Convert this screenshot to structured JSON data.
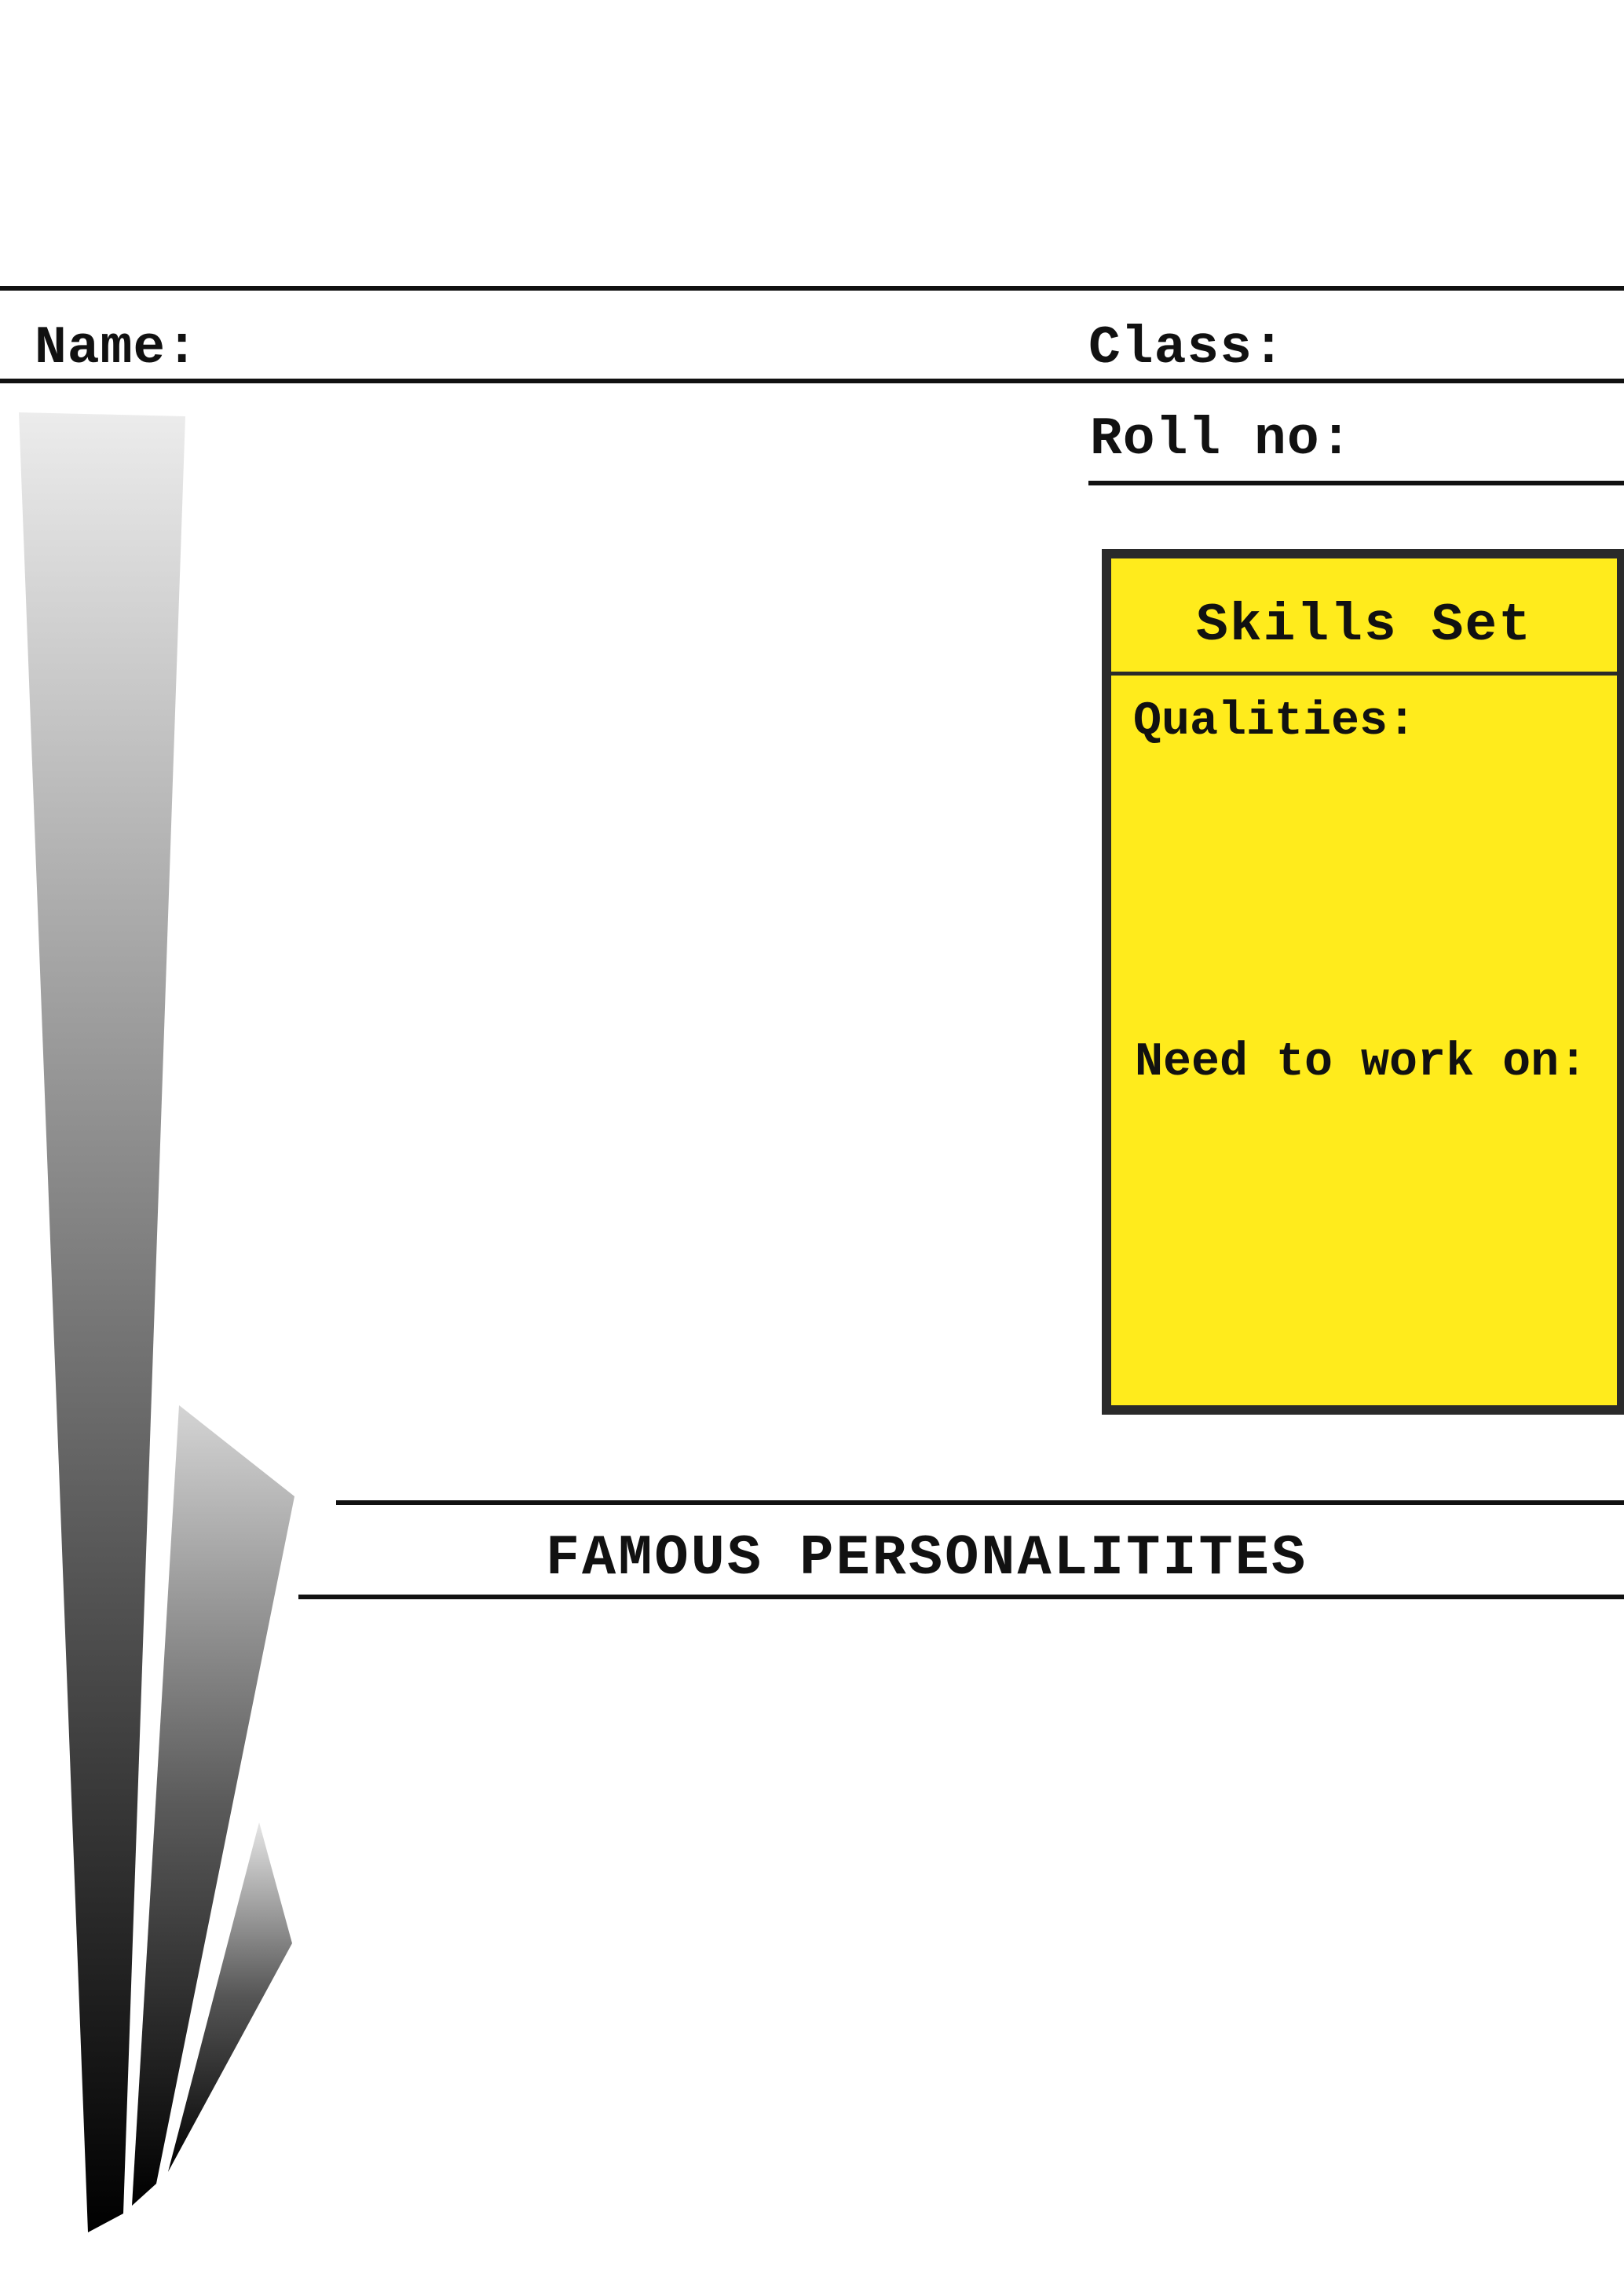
{
  "header": {
    "name_label": "Name:",
    "class_label": "Class:",
    "roll_label": "Roll no:"
  },
  "skills": {
    "title": "Skills Set",
    "qualities_label": "Qualities:",
    "work_on_label": "Need to work on:"
  },
  "section": {
    "heading": "FAMOUS PERSONALITITES"
  },
  "colors": {
    "skills_fill": "#ffeb1c",
    "border": "#2a2a2a",
    "ink": "#111111"
  }
}
